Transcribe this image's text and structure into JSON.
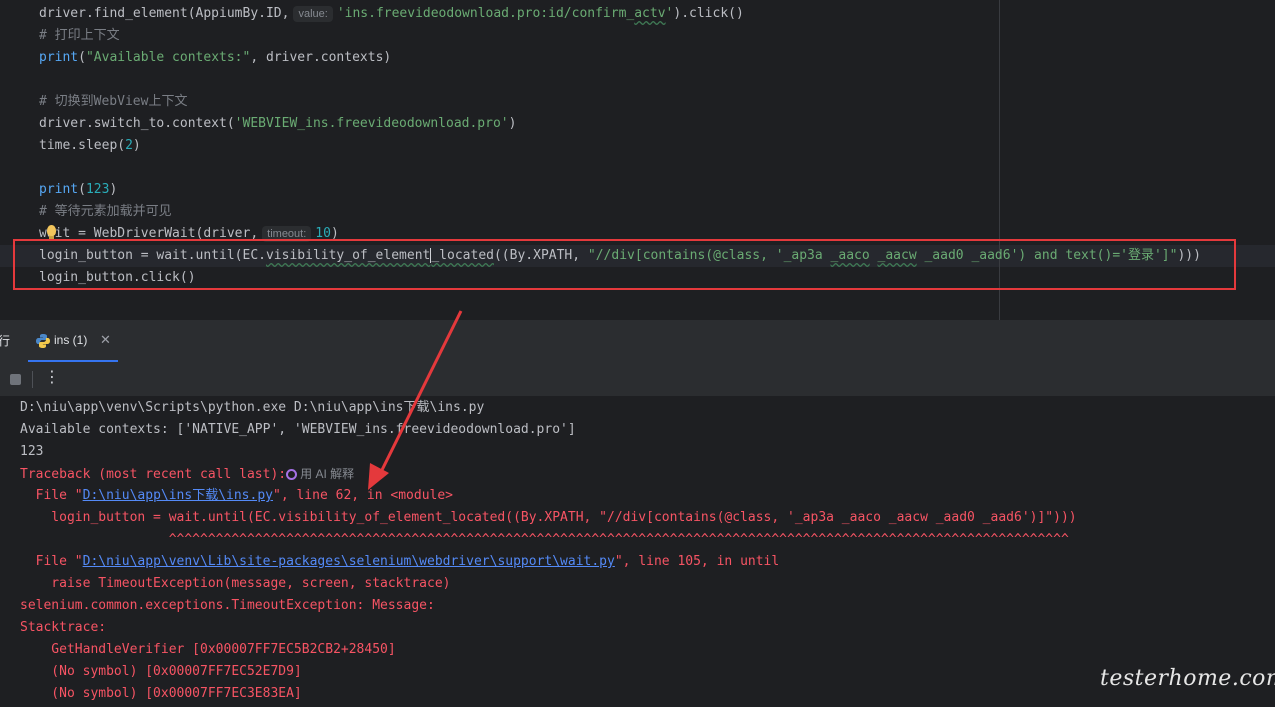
{
  "editor": {
    "lines": [
      {
        "parts": [
          {
            "t": "driver.find_element(AppiumBy.ID,",
            "c": ""
          },
          {
            "t": "value:",
            "c": "hint"
          },
          {
            "t": "'ins.freevideodownload.pro:id/confirm_",
            "c": "str"
          },
          {
            "t": "actv",
            "c": "str und"
          },
          {
            "t": "'",
            "c": "str"
          },
          {
            "t": ").click()",
            "c": ""
          }
        ]
      },
      {
        "parts": [
          {
            "t": "# 打印上下文",
            "c": "cmt"
          }
        ]
      },
      {
        "parts": [
          {
            "t": "print",
            "c": "fn"
          },
          {
            "t": "(",
            "c": ""
          },
          {
            "t": "\"Available contexts:\"",
            "c": "str"
          },
          {
            "t": ", driver.contexts)",
            "c": ""
          }
        ]
      },
      {
        "parts": []
      },
      {
        "parts": [
          {
            "t": "# 切换到WebView上下文",
            "c": "cmt"
          }
        ]
      },
      {
        "parts": [
          {
            "t": "driver.switch_to.context(",
            "c": ""
          },
          {
            "t": "'WEBVIEW_ins.freevideodownload.pro'",
            "c": "str"
          },
          {
            "t": ")",
            "c": ""
          }
        ]
      },
      {
        "parts": [
          {
            "t": "time.sleep(",
            "c": ""
          },
          {
            "t": "2",
            "c": "num"
          },
          {
            "t": ")",
            "c": ""
          }
        ]
      },
      {
        "parts": []
      },
      {
        "parts": [
          {
            "t": "print",
            "c": "fn"
          },
          {
            "t": "(",
            "c": ""
          },
          {
            "t": "123",
            "c": "num"
          },
          {
            "t": ")",
            "c": ""
          }
        ]
      },
      {
        "parts": [
          {
            "t": "# 等待元素加载并可见",
            "c": "cmt"
          }
        ]
      },
      {
        "parts": [
          {
            "t": "wait = WebDriverWait(driver,",
            "c": ""
          },
          {
            "t": "timeout:",
            "c": "hint"
          },
          {
            "t": "10",
            "c": "num"
          },
          {
            "t": ")",
            "c": ""
          }
        ]
      },
      {
        "parts": [
          {
            "t": "login_button = wait.until(EC.",
            "c": ""
          },
          {
            "t": "visibility_of_element",
            "c": "und"
          },
          {
            "t": "",
            "c": "caret"
          },
          {
            "t": "_located",
            "c": "und"
          },
          {
            "t": "((By.XPATH, ",
            "c": ""
          },
          {
            "t": "\"//div[contains(@class, '_ap3a ",
            "c": "str"
          },
          {
            "t": "_aaco",
            "c": "str und"
          },
          {
            "t": " ",
            "c": "str"
          },
          {
            "t": "_aacw",
            "c": "str und"
          },
          {
            "t": " _aad0 _aad6') and text()='登录']\"",
            "c": "str"
          },
          {
            "t": ")))",
            "c": ""
          }
        ]
      },
      {
        "parts": [
          {
            "t": "login_button.click()",
            "c": ""
          }
        ]
      }
    ]
  },
  "run_tabs": {
    "partial_label": "行",
    "active_tab": {
      "label": "ins (1)",
      "close": "✕"
    }
  },
  "toolbar": {
    "more": "⋮"
  },
  "console": {
    "lines": [
      {
        "parts": [
          {
            "t": "D:\\niu\\app\\venv\\Scripts\\python.exe D:\\niu\\app\\ins下载\\ins.py",
            "c": "white"
          }
        ]
      },
      {
        "parts": [
          {
            "t": "Available contexts: ['NATIVE_APP', 'WEBVIEW_ins.freevideodownload.pro']",
            "c": "white"
          }
        ]
      },
      {
        "parts": [
          {
            "t": "123",
            "c": "white"
          }
        ]
      },
      {
        "parts": [
          {
            "t": "Traceback (most recent call last):",
            "c": "err"
          },
          {
            "t": "用 AI 解释",
            "c": "ai"
          }
        ]
      },
      {
        "parts": [
          {
            "t": "  File \"",
            "c": "err"
          },
          {
            "t": "D:\\niu\\app\\ins下载\\ins.py",
            "c": "link"
          },
          {
            "t": "\", line 62, in <module>",
            "c": "err"
          }
        ]
      },
      {
        "parts": [
          {
            "t": "    login_button = wait.until(EC.visibility_of_element_located((By.XPATH, \"//div[contains(@class, '_ap3a _aaco _aacw _aad0 _aad6')]\")))",
            "c": "err"
          }
        ]
      },
      {
        "parts": [
          {
            "t": "                   ^^^^^^^^^^^^^^^^^^^^^^^^^^^^^^^^^^^^^^^^^^^^^^^^^^^^^^^^^^^^^^^^^^^^^^^^^^^^^^^^^^^^^^^^^^^^^^^^^^^^^^^^^^^^^^^^^^^",
            "c": "carets"
          }
        ]
      },
      {
        "parts": [
          {
            "t": "  File \"",
            "c": "err"
          },
          {
            "t": "D:\\niu\\app\\venv\\Lib\\site-packages\\selenium\\webdriver\\support\\wait.py",
            "c": "link"
          },
          {
            "t": "\", line 105, in until",
            "c": "err"
          }
        ]
      },
      {
        "parts": [
          {
            "t": "    raise TimeoutException(message, screen, stacktrace)",
            "c": "err"
          }
        ]
      },
      {
        "parts": [
          {
            "t": "selenium.common.exceptions.TimeoutException: Message: ",
            "c": "err"
          }
        ]
      },
      {
        "parts": [
          {
            "t": "Stacktrace:",
            "c": "err"
          }
        ]
      },
      {
        "parts": [
          {
            "t": "    GetHandleVerifier [0x00007FF7EC5B2CB2+28450]",
            "c": "err"
          }
        ]
      },
      {
        "parts": [
          {
            "t": "    (No symbol) [0x00007FF7EC52E7D9]",
            "c": "err"
          }
        ]
      },
      {
        "parts": [
          {
            "t": "    (No symbol) [0x00007FF7EC3E83EA]",
            "c": "err"
          }
        ]
      }
    ]
  },
  "watermark": "testerhome.com",
  "colors": {
    "annotation_red": "#e4393c",
    "accent_blue": "#3574f0",
    "error_red": "#f75464",
    "link_blue": "#548af7"
  }
}
